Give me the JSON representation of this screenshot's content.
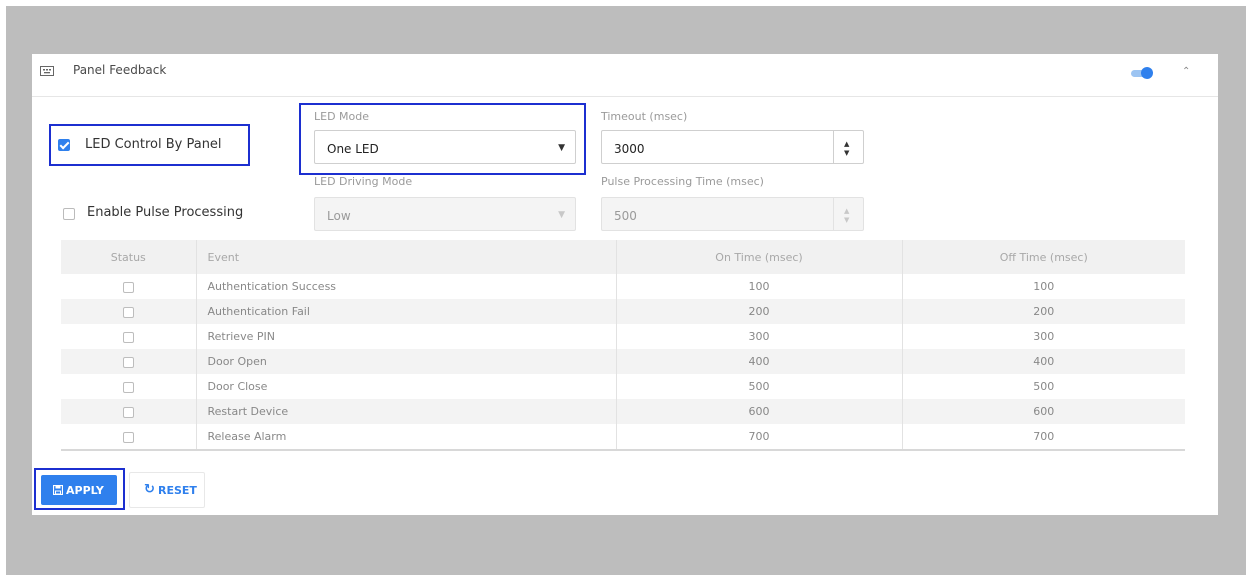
{
  "panel": {
    "title": "Panel Feedback",
    "title_icon": "keyboard-icon",
    "enabled_toggle": true,
    "collapse_icon": "chevron-up-icon"
  },
  "settings": {
    "led_control": {
      "label": "LED Control By Panel",
      "checked": true
    },
    "pulse_processing": {
      "label": "Enable Pulse Processing",
      "checked": false
    },
    "led_mode": {
      "label": "LED Mode",
      "value": "One LED"
    },
    "led_driving_mode": {
      "label": "LED Driving Mode",
      "value": "Low"
    },
    "timeout": {
      "label": "Timeout (msec)",
      "value": "3000"
    },
    "pulse_time": {
      "label": "Pulse Processing Time (msec)",
      "value": "500"
    }
  },
  "table": {
    "headers": {
      "status": "Status",
      "event": "Event",
      "on": "On Time (msec)",
      "off": "Off Time (msec)"
    },
    "rows": [
      {
        "event": "Authentication Success",
        "on": "100",
        "off": "100"
      },
      {
        "event": "Authentication Fail",
        "on": "200",
        "off": "200"
      },
      {
        "event": "Retrieve PIN",
        "on": "300",
        "off": "300"
      },
      {
        "event": "Door Open",
        "on": "400",
        "off": "400"
      },
      {
        "event": "Door Close",
        "on": "500",
        "off": "500"
      },
      {
        "event": "Restart Device",
        "on": "600",
        "off": "600"
      },
      {
        "event": "Release Alarm",
        "on": "700",
        "off": "700"
      }
    ]
  },
  "buttons": {
    "apply": "APPLY",
    "reset": "RESET"
  },
  "colors": {
    "accent": "#2f80ed",
    "highlight": "#1c2fd0",
    "backdrop": "#bdbdbd"
  }
}
